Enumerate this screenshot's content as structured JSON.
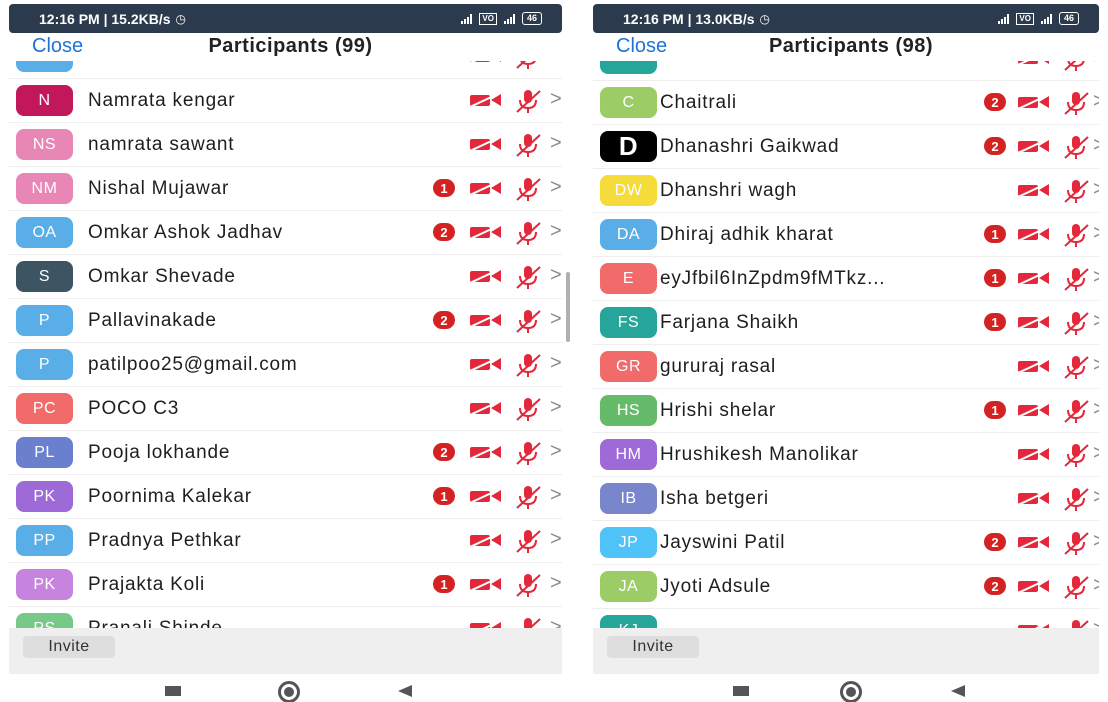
{
  "icons": {
    "camera": "video-off-icon",
    "mic": "mic-muted-icon",
    "chevron": "chevron-right-icon"
  },
  "colors": {
    "accent": "#1f73d6",
    "muted_red": "#e2283a",
    "badge": "#d42222",
    "status_bar": "#2b3a4c"
  },
  "left": {
    "status": {
      "time": "12:16 PM | 15.2KB/s",
      "battery": "46"
    },
    "header": {
      "close": "Close",
      "title": "Participants (99)"
    },
    "participants": [
      {
        "initials": "",
        "name": "",
        "color": "#5aaee8",
        "badge": ""
      },
      {
        "initials": "N",
        "name": "Namrata kengar",
        "color": "#c2185b",
        "badge": ""
      },
      {
        "initials": "NS",
        "name": "namrata sawant",
        "color": "#e887b6",
        "badge": ""
      },
      {
        "initials": "NM",
        "name": "Nishal Mujawar",
        "color": "#e887b6",
        "badge": "1"
      },
      {
        "initials": "OA",
        "name": "Omkar Ashok Jadhav",
        "color": "#5aaee8",
        "badge": "2"
      },
      {
        "initials": "S",
        "name": "Omkar Shevade",
        "color": "#3d5563",
        "badge": ""
      },
      {
        "initials": "P",
        "name": "Pallavinakade",
        "color": "#5aaee8",
        "badge": "2"
      },
      {
        "initials": "P",
        "name": "patilpoo25@gmail.com",
        "color": "#5aaee8",
        "badge": ""
      },
      {
        "initials": "PC",
        "name": "POCO C3",
        "color": "#f26b6b",
        "badge": ""
      },
      {
        "initials": "PL",
        "name": "Pooja lokhande",
        "color": "#6b7fcf",
        "badge": "2"
      },
      {
        "initials": "PK",
        "name": "Poornima Kalekar",
        "color": "#9d6ad8",
        "badge": "1"
      },
      {
        "initials": "PP",
        "name": "Pradnya Pethkar",
        "color": "#5aaee8",
        "badge": ""
      },
      {
        "initials": "PK",
        "name": "Prajakta Koli",
        "color": "#c784de",
        "badge": "1"
      },
      {
        "initials": "PS",
        "name": "Pranali Shinde",
        "color": "#78c987",
        "badge": ""
      }
    ],
    "invite": "Invite"
  },
  "right": {
    "status": {
      "time": "12:16 PM | 13.0KB/s",
      "battery": "46"
    },
    "header": {
      "close": "Close",
      "title": "Participants (98)"
    },
    "participants": [
      {
        "initials": "",
        "name": "",
        "color": "#26a69a",
        "badge": ""
      },
      {
        "initials": "C",
        "name": "Chaitrali",
        "color": "#9ccc65",
        "badge": "2"
      },
      {
        "initials": "D",
        "name": "Dhanashri Gaikwad",
        "color": "#000000",
        "badge": "2"
      },
      {
        "initials": "DW",
        "name": "Dhanshri wagh",
        "color": "#f5dc3a",
        "badge": ""
      },
      {
        "initials": "DA",
        "name": "Dhiraj adhik kharat",
        "color": "#5aaee8",
        "badge": "1"
      },
      {
        "initials": "E",
        "name": "eyJfbil6InZpdm9fMTkz...",
        "color": "#f26b6b",
        "badge": "1"
      },
      {
        "initials": "FS",
        "name": "Farjana Shaikh",
        "color": "#26a69a",
        "badge": "1"
      },
      {
        "initials": "GR",
        "name": "gururaj rasal",
        "color": "#f26b6b",
        "badge": ""
      },
      {
        "initials": "HS",
        "name": "Hrishi shelar",
        "color": "#66bb6a",
        "badge": "1"
      },
      {
        "initials": "HM",
        "name": "Hrushikesh Manolikar",
        "color": "#9d6ad8",
        "badge": ""
      },
      {
        "initials": "IB",
        "name": "Isha betgeri",
        "color": "#7986cb",
        "badge": ""
      },
      {
        "initials": "JP",
        "name": "Jayswini Patil",
        "color": "#4fc3f7",
        "badge": "2"
      },
      {
        "initials": "JA",
        "name": "Jyoti Adsule",
        "color": "#9ccc65",
        "badge": "2"
      },
      {
        "initials": "KJ",
        "name": "",
        "color": "#26a69a",
        "badge": ""
      }
    ],
    "invite": "Invite"
  }
}
